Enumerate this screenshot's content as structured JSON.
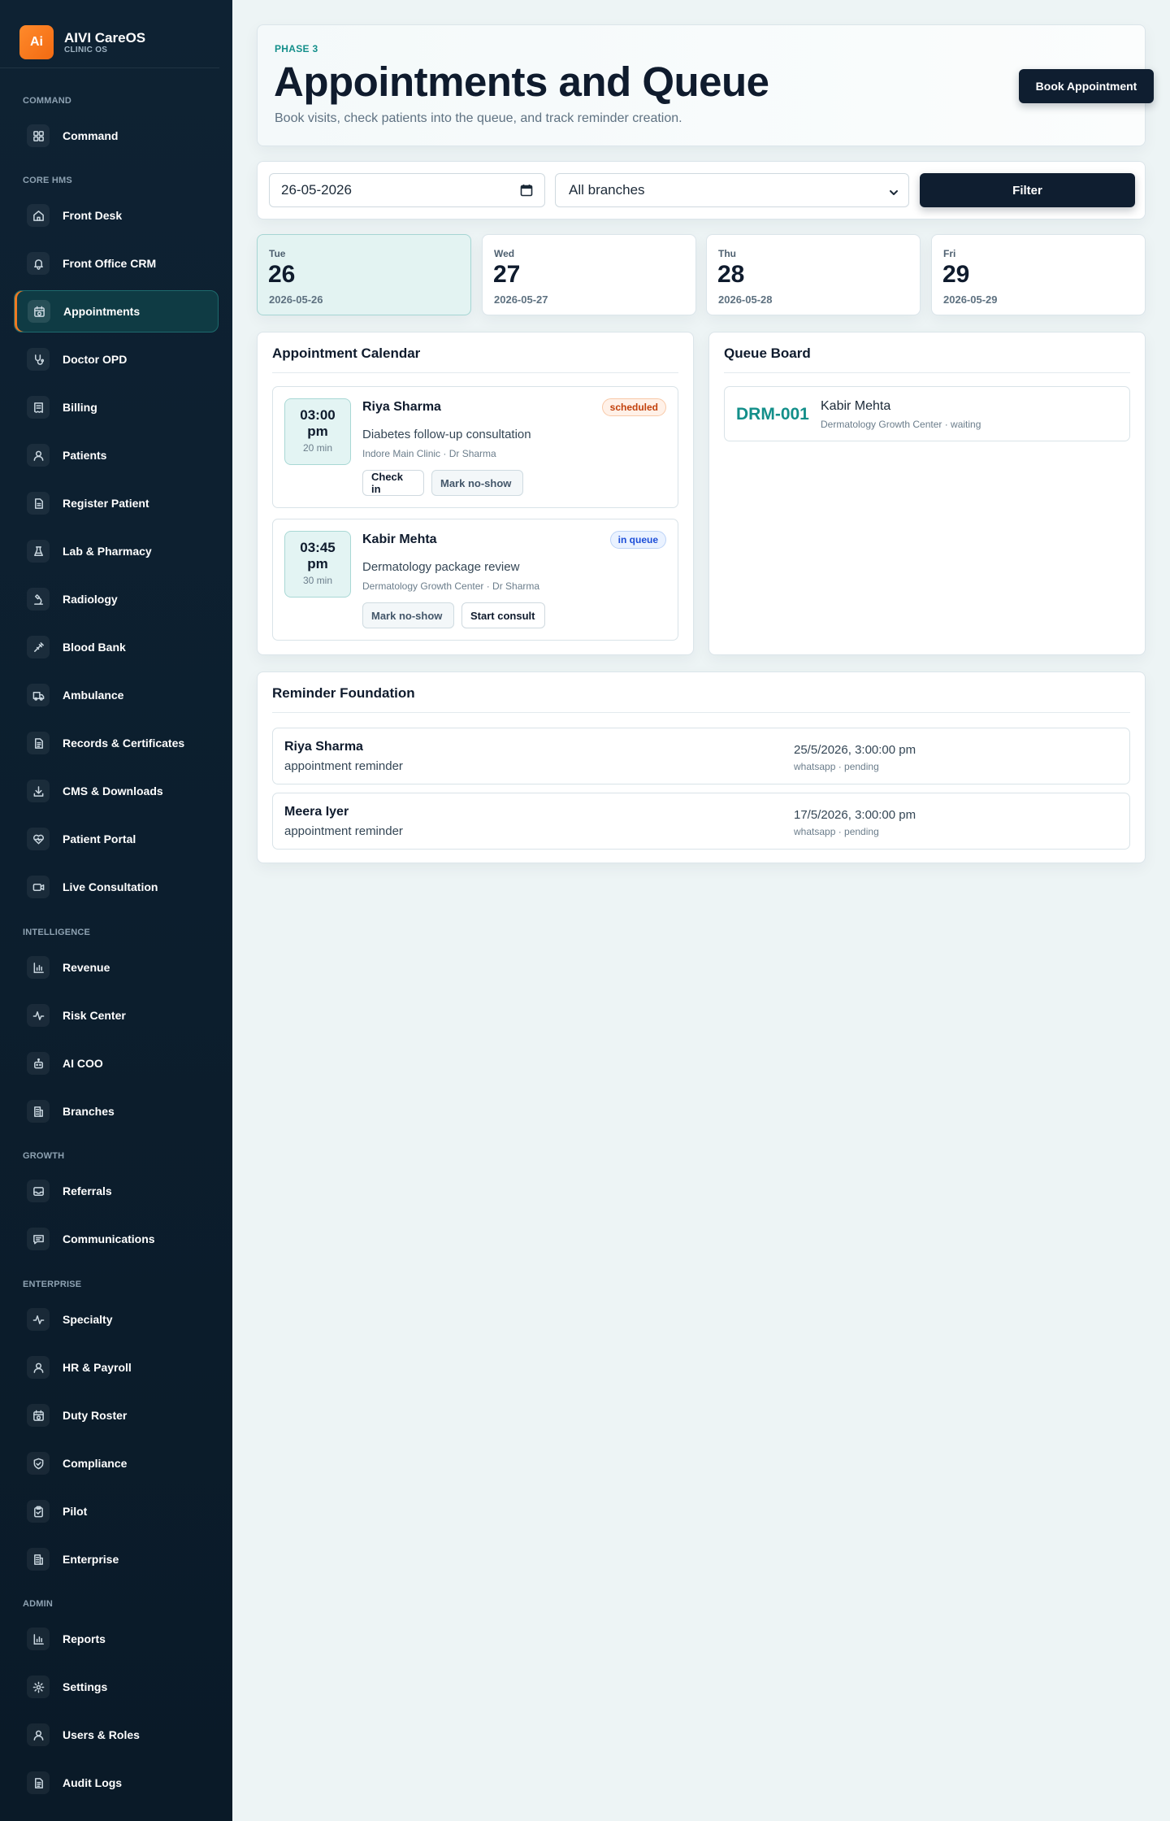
{
  "brand": {
    "logo": "Ai",
    "name": "AIVI CareOS",
    "sub": "CLINIC OS"
  },
  "sidebar": {
    "sections": {
      "command": "COMMAND",
      "core": "CORE HMS",
      "intelligence": "INTELLIGENCE",
      "growth": "GROWTH",
      "enterprise": "ENTERPRISE",
      "admin": "ADMIN"
    },
    "items": [
      {
        "label": "Command",
        "icon": "grid-icon"
      },
      {
        "label": "Front Desk",
        "icon": "home-icon"
      },
      {
        "label": "Front Office CRM",
        "icon": "bell-icon"
      },
      {
        "label": "Appointments",
        "icon": "calendar-clock-icon",
        "active": true
      },
      {
        "label": "Doctor OPD",
        "icon": "stethoscope-icon"
      },
      {
        "label": "Billing",
        "icon": "receipt-icon"
      },
      {
        "label": "Patients",
        "icon": "users-icon"
      },
      {
        "label": "Register Patient",
        "icon": "file-plus-icon"
      },
      {
        "label": "Lab & Pharmacy",
        "icon": "flask-icon"
      },
      {
        "label": "Radiology",
        "icon": "microscope-icon"
      },
      {
        "label": "Blood Bank",
        "icon": "syringe-icon"
      },
      {
        "label": "Ambulance",
        "icon": "ambulance-icon"
      },
      {
        "label": "Records & Certificates",
        "icon": "document-icon"
      },
      {
        "label": "CMS & Downloads",
        "icon": "download-icon"
      },
      {
        "label": "Patient Portal",
        "icon": "heart-pulse-icon"
      },
      {
        "label": "Live Consultation",
        "icon": "video-icon"
      },
      {
        "label": "Revenue",
        "icon": "bar-chart-icon"
      },
      {
        "label": "Risk Center",
        "icon": "activity-icon"
      },
      {
        "label": "AI COO",
        "icon": "bot-icon"
      },
      {
        "label": "Branches",
        "icon": "building-icon"
      },
      {
        "label": "Referrals",
        "icon": "inbox-icon"
      },
      {
        "label": "Communications",
        "icon": "message-icon"
      },
      {
        "label": "Specialty",
        "icon": "activity-icon"
      },
      {
        "label": "HR & Payroll",
        "icon": "users-icon"
      },
      {
        "label": "Duty Roster",
        "icon": "calendar-clock-icon"
      },
      {
        "label": "Compliance",
        "icon": "shield-icon"
      },
      {
        "label": "Pilot",
        "icon": "clipboard-icon"
      },
      {
        "label": "Enterprise",
        "icon": "building-icon"
      },
      {
        "label": "Reports",
        "icon": "bar-chart-icon"
      },
      {
        "label": "Settings",
        "icon": "gear-icon"
      },
      {
        "label": "Users & Roles",
        "icon": "users-icon"
      },
      {
        "label": "Audit Logs",
        "icon": "document-icon"
      }
    ]
  },
  "header": {
    "phase": "PHASE 3",
    "title": "Appointments and Queue",
    "subtitle": "Book visits, check patients into the queue, and track reminder creation.",
    "book_label": "Book Appointment"
  },
  "filters": {
    "date_value": "26-05-2026",
    "branch_value": "All branches",
    "filter_label": "Filter"
  },
  "days": [
    {
      "dow": "Tue",
      "num": "26",
      "date": "2026-05-26",
      "active": true
    },
    {
      "dow": "Wed",
      "num": "27",
      "date": "2026-05-27"
    },
    {
      "dow": "Thu",
      "num": "28",
      "date": "2026-05-28"
    },
    {
      "dow": "Fri",
      "num": "29",
      "date": "2026-05-29"
    }
  ],
  "calendar": {
    "title": "Appointment Calendar",
    "appointments": [
      {
        "time": "03:00 pm",
        "duration": "20 min",
        "patient": "Riya Sharma",
        "status": "scheduled",
        "reason": "Diabetes follow-up consultation",
        "meta": "Indore Main Clinic · Dr Sharma",
        "actions": [
          "Check in",
          "Mark no-show"
        ]
      },
      {
        "time": "03:45 pm",
        "duration": "30 min",
        "patient": "Kabir Mehta",
        "status": "in queue",
        "reason": "Dermatology package review",
        "meta": "Dermatology Growth Center · Dr Sharma",
        "actions": [
          "Mark no-show",
          "Start consult"
        ]
      }
    ]
  },
  "queue": {
    "title": "Queue Board",
    "items": [
      {
        "token": "DRM-001",
        "name": "Kabir Mehta",
        "meta": "Dermatology Growth Center · waiting"
      }
    ]
  },
  "reminders": {
    "title": "Reminder Foundation",
    "items": [
      {
        "name": "Riya Sharma",
        "type": "appointment reminder",
        "time": "25/5/2026, 3:00:00 pm",
        "meta": "whatsapp · pending"
      },
      {
        "name": "Meera Iyer",
        "type": "appointment reminder",
        "time": "17/5/2026, 3:00:00 pm",
        "meta": "whatsapp · pending"
      }
    ]
  },
  "colors": {
    "accent": "#138f8a",
    "brand_orange": "#f26a12",
    "sidebar_bg": "#0a1a28",
    "button_dark": "#0f1e30"
  }
}
